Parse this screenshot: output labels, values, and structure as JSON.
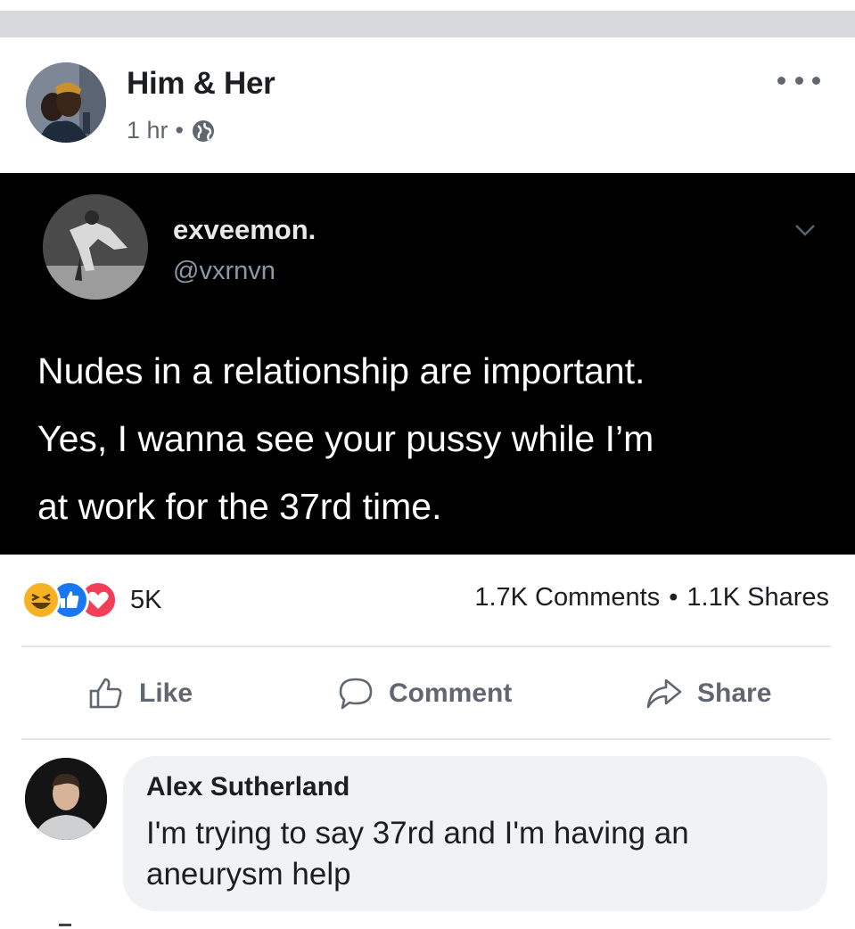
{
  "post": {
    "author": "Him & Her",
    "time": "1 hr",
    "separator": "•",
    "more_icon": "ellipsis-icon",
    "privacy_icon": "globe-icon"
  },
  "tweet": {
    "display_name": "exveemon.",
    "handle": "@vxrnvn",
    "lines": [
      "Nudes in a relationship are important.",
      "Yes, I wanna see your pussy while I’m",
      "at work for the 37rd time."
    ]
  },
  "stats": {
    "reactions": [
      "haha-icon",
      "like-icon",
      "love-icon"
    ],
    "reaction_count": "5K",
    "comments": "1.7K Comments",
    "dot": "•",
    "shares": "1.1K Shares"
  },
  "actions": {
    "like": "Like",
    "comment": "Comment",
    "share": "Share"
  },
  "comment": {
    "author": "Alex Sutherland",
    "text_lines": [
      "I'm trying to say 37rd and I'm having an",
      "aneurysm help"
    ]
  },
  "colors": {
    "text_primary": "#1c1e21",
    "text_secondary": "#606770",
    "like_blue": "#1877f2",
    "love_red": "#f33e58",
    "haha_yellow": "#f7b125",
    "tweet_bg": "#000000",
    "comment_bubble": "#f0f2f5"
  }
}
